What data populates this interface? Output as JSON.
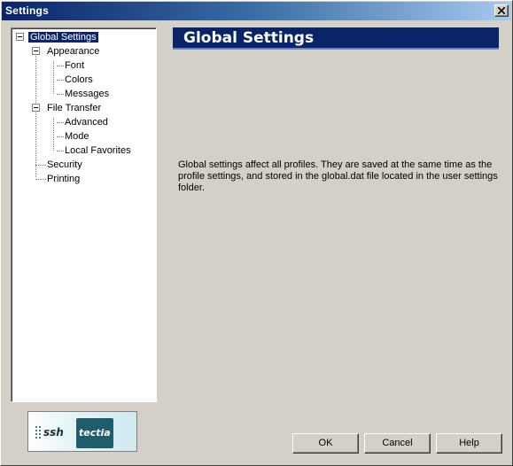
{
  "window": {
    "title": "Settings",
    "close_icon": "close-icon"
  },
  "tree": {
    "items": [
      {
        "label": "Global Settings",
        "level": 0,
        "expanded": true,
        "selected": true
      },
      {
        "label": "Appearance",
        "level": 1,
        "expanded": true
      },
      {
        "label": "Font",
        "level": 2
      },
      {
        "label": "Colors",
        "level": 2
      },
      {
        "label": "Messages",
        "level": 2
      },
      {
        "label": "File Transfer",
        "level": 1,
        "expanded": true
      },
      {
        "label": "Advanced",
        "level": 2
      },
      {
        "label": "Mode",
        "level": 2
      },
      {
        "label": "Local Favorites",
        "level": 2
      },
      {
        "label": "Security",
        "level": 1
      },
      {
        "label": "Printing",
        "level": 1
      }
    ]
  },
  "main": {
    "header": "Global Settings",
    "description": "Global settings affect all profiles. They are saved at the same time as the profile settings, and stored in the global.dat file located in the user settings folder."
  },
  "logo": {
    "left_text": "ssh",
    "right_text": "tectia"
  },
  "buttons": {
    "ok": "OK",
    "cancel": "Cancel",
    "help": "Help"
  }
}
